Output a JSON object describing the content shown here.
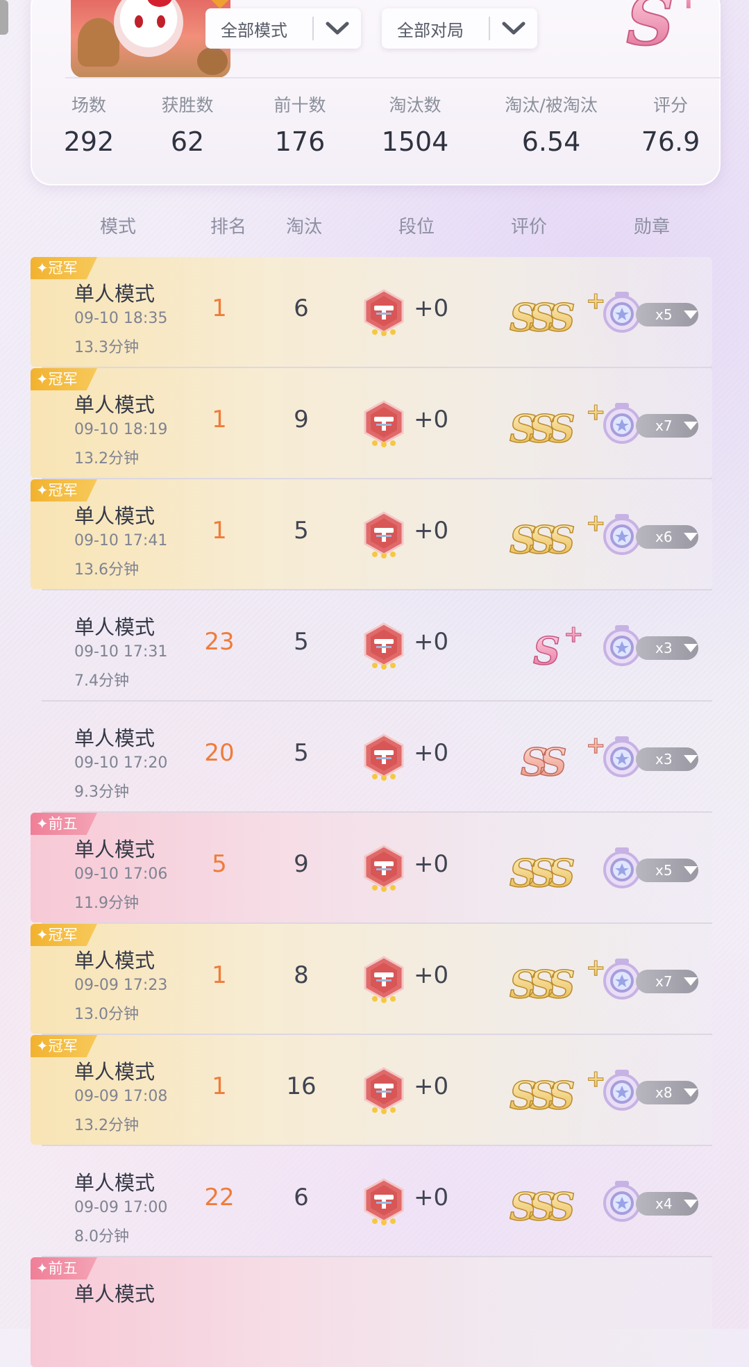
{
  "filters": {
    "mode_label": "全部模式",
    "match_label": "全部对局"
  },
  "overall_rating": {
    "grade": "S",
    "plus": "+"
  },
  "stats": [
    {
      "label": "场数",
      "value": "292"
    },
    {
      "label": "获胜数",
      "value": "62"
    },
    {
      "label": "前十数",
      "value": "176"
    },
    {
      "label": "淘汰数",
      "value": "1504"
    },
    {
      "label": "淘汰/被淘汰",
      "value": "6.54"
    },
    {
      "label": "评分",
      "value": "76.9"
    }
  ],
  "table_header": {
    "mode": "模式",
    "rank": "排名",
    "elim": "淘汰",
    "tier": "段位",
    "rating": "评价",
    "medals": "勋章"
  },
  "colors": {
    "rank_orange": "#ee7c3a",
    "gold_tag": "#f2b22f",
    "pink_tag": "#ef7f97"
  },
  "matches": [
    {
      "tag": "冠军",
      "tag_type": "gold",
      "mode": "单人模式",
      "time": "09-10 18:35",
      "duration": "13.3分钟",
      "rank": "1",
      "elims": "6",
      "tier_delta": "+0",
      "grade": "SSS",
      "grade_plus": "+",
      "grade_color": "gold",
      "medal_count": "x5"
    },
    {
      "tag": "冠军",
      "tag_type": "gold",
      "mode": "单人模式",
      "time": "09-10 18:19",
      "duration": "13.2分钟",
      "rank": "1",
      "elims": "9",
      "tier_delta": "+0",
      "grade": "SSS",
      "grade_plus": "+",
      "grade_color": "gold",
      "medal_count": "x7"
    },
    {
      "tag": "冠军",
      "tag_type": "gold",
      "mode": "单人模式",
      "time": "09-10 17:41",
      "duration": "13.6分钟",
      "rank": "1",
      "elims": "5",
      "tier_delta": "+0",
      "grade": "SSS",
      "grade_plus": "+",
      "grade_color": "gold",
      "medal_count": "x6"
    },
    {
      "tag": "",
      "tag_type": "none",
      "mode": "单人模式",
      "time": "09-10 17:31",
      "duration": "7.4分钟",
      "rank": "23",
      "elims": "5",
      "tier_delta": "+0",
      "grade": "S",
      "grade_plus": "+",
      "grade_color": "pink",
      "medal_count": "x3"
    },
    {
      "tag": "",
      "tag_type": "none",
      "mode": "单人模式",
      "time": "09-10 17:20",
      "duration": "9.3分钟",
      "rank": "20",
      "elims": "5",
      "tier_delta": "+0",
      "grade": "SS",
      "grade_plus": "+",
      "grade_color": "rose",
      "medal_count": "x3"
    },
    {
      "tag": "前五",
      "tag_type": "pink",
      "mode": "单人模式",
      "time": "09-10 17:06",
      "duration": "11.9分钟",
      "rank": "5",
      "elims": "9",
      "tier_delta": "+0",
      "grade": "SSS",
      "grade_plus": "",
      "grade_color": "gold",
      "medal_count": "x5"
    },
    {
      "tag": "冠军",
      "tag_type": "gold",
      "mode": "单人模式",
      "time": "09-09 17:23",
      "duration": "13.0分钟",
      "rank": "1",
      "elims": "8",
      "tier_delta": "+0",
      "grade": "SSS",
      "grade_plus": "+",
      "grade_color": "gold",
      "medal_count": "x7"
    },
    {
      "tag": "冠军",
      "tag_type": "gold",
      "mode": "单人模式",
      "time": "09-09 17:08",
      "duration": "13.2分钟",
      "rank": "1",
      "elims": "16",
      "tier_delta": "+0",
      "grade": "SSS",
      "grade_plus": "+",
      "grade_color": "gold",
      "medal_count": "x8"
    },
    {
      "tag": "",
      "tag_type": "none",
      "mode": "单人模式",
      "time": "09-09 17:00",
      "duration": "8.0分钟",
      "rank": "22",
      "elims": "6",
      "tier_delta": "+0",
      "grade": "SSS",
      "grade_plus": "",
      "grade_color": "gold",
      "medal_count": "x4"
    },
    {
      "tag": "前五",
      "tag_type": "pink",
      "mode": "单人模式",
      "time": "",
      "duration": "",
      "rank": "",
      "elims": "",
      "tier_delta": "",
      "grade": "",
      "grade_plus": "",
      "grade_color": "none",
      "medal_count": ""
    }
  ]
}
